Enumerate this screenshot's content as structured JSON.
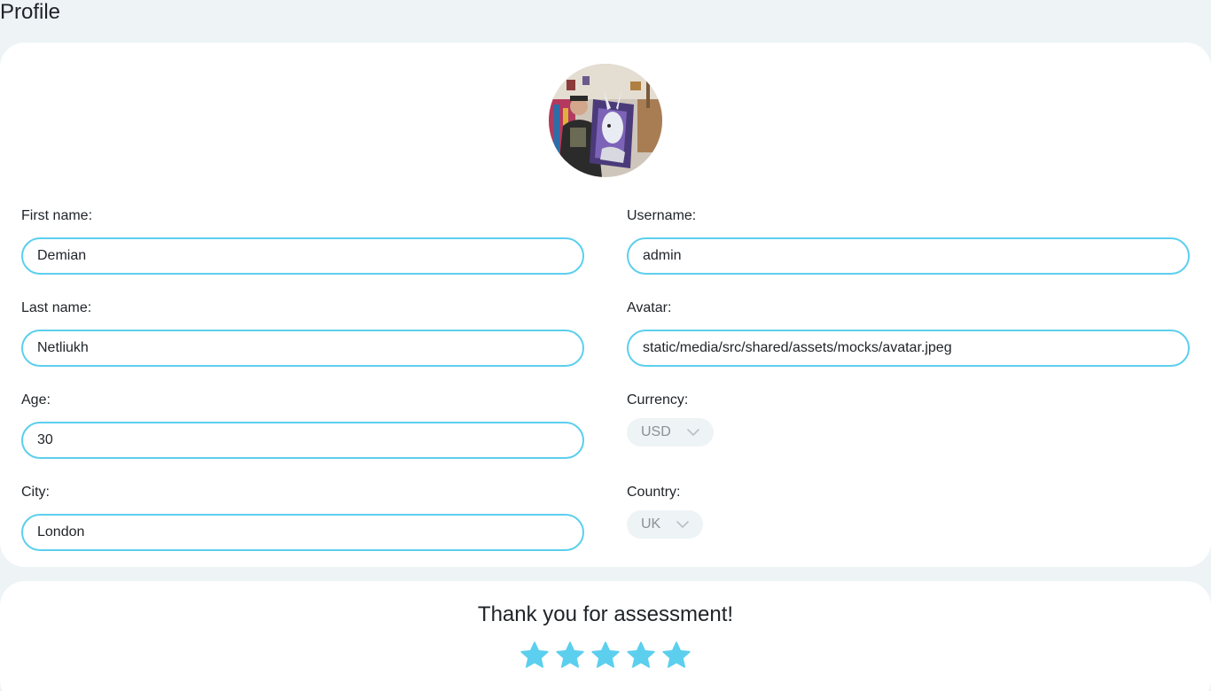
{
  "page": {
    "title": "Profile"
  },
  "profile": {
    "first_name": {
      "label": "First name:",
      "value": "Demian"
    },
    "last_name": {
      "label": "Last name:",
      "value": "Netliukh"
    },
    "age": {
      "label": "Age:",
      "value": "30"
    },
    "city": {
      "label": "City:",
      "value": "London"
    },
    "username": {
      "label": "Username:",
      "value": "admin"
    },
    "avatar": {
      "label": "Avatar:",
      "value": "static/media/src/shared/assets/mocks/avatar.jpeg"
    },
    "currency": {
      "label": "Currency:",
      "selected": "USD"
    },
    "country": {
      "label": "Country:",
      "selected": "UK"
    }
  },
  "rating": {
    "title": "Thank you for assessment!",
    "stars_selected": 5,
    "stars_total": 5
  },
  "colors": {
    "accent": "#5ccfee",
    "background": "#eef3f6",
    "card": "#ffffff"
  },
  "icons": {
    "select": "chevron-down-icon",
    "rating": "star-icon"
  }
}
